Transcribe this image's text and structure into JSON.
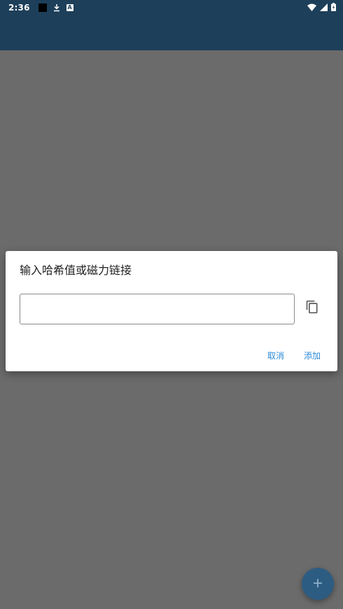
{
  "status_bar": {
    "time": "2:36",
    "left_icons": [
      "notification-square-icon",
      "download-icon",
      "a-badge-icon"
    ],
    "a_badge_text": "A",
    "right_icons": [
      "wifi-icon",
      "signal-icon",
      "battery-icon"
    ]
  },
  "colors": {
    "app_bar": "#1d3f5a",
    "scrim_background": "#6b6b6b",
    "accent": "#2b8ad6",
    "fab": "#2d5c82"
  },
  "dialog": {
    "title": "输入哈希值或磁力链接",
    "input": {
      "value": "",
      "placeholder": ""
    },
    "paste_icon": "content-copy-icon",
    "actions": {
      "cancel_label": "取消",
      "add_label": "添加"
    }
  },
  "fab": {
    "icon": "plus-icon"
  }
}
